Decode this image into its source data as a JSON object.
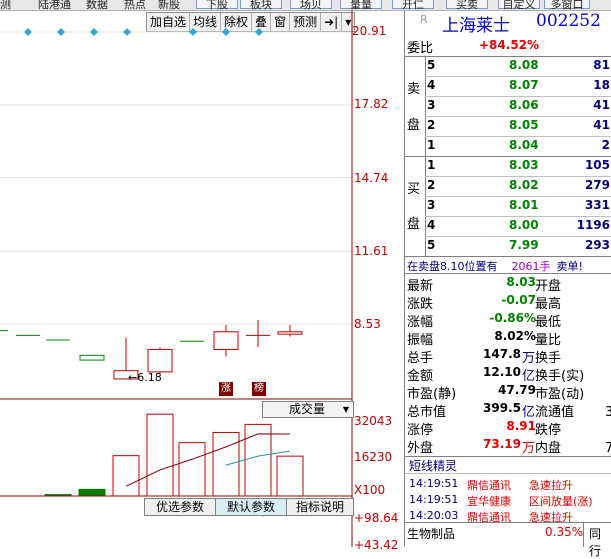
{
  "top_tabs": [
    "测",
    "陆港通",
    "数据",
    "热点",
    "新股"
  ],
  "top_buttons": [
    "下股",
    "板块",
    "场贝",
    "量量",
    "开仁",
    "买卖",
    "自定义",
    "多窗口"
  ],
  "chart_toolbar": [
    "加自选",
    "均线",
    "除权",
    "叠",
    "窗",
    "预测",
    "➜|",
    "▾"
  ],
  "price_axis": [
    "20.91",
    "17.82",
    "14.74",
    "11.61",
    "8.53"
  ],
  "volume_axis": [
    "32043",
    "16230",
    "X100"
  ],
  "indicator_axis": [
    "+98.64",
    "+43.42"
  ],
  "low_marker": "6.18",
  "markers": {
    "zhang": "涨",
    "bang": "榜"
  },
  "volume_dropdown": "成交量",
  "bottom_buttons": [
    "优选参数",
    "默认参数",
    "指标说明"
  ],
  "stock": {
    "name": "上海莱士",
    "code": "002252",
    "prefix": "R"
  },
  "order_ratio": {
    "label": "委比",
    "value": "+84.52%"
  },
  "sell_label": [
    "卖",
    "盘"
  ],
  "buy_label": [
    "买",
    "盘"
  ],
  "sell_orders": [
    {
      "level": "5",
      "price": "8.08",
      "vol": "81"
    },
    {
      "level": "4",
      "price": "8.07",
      "vol": "18"
    },
    {
      "level": "3",
      "price": "8.06",
      "vol": "41"
    },
    {
      "level": "2",
      "price": "8.05",
      "vol": "41"
    },
    {
      "level": "1",
      "price": "8.04",
      "vol": "2"
    }
  ],
  "buy_orders": [
    {
      "level": "1",
      "price": "8.03",
      "vol": "105"
    },
    {
      "level": "2",
      "price": "8.02",
      "vol": "279"
    },
    {
      "level": "3",
      "price": "8.01",
      "vol": "331"
    },
    {
      "level": "4",
      "price": "8.00",
      "vol": "1196"
    },
    {
      "level": "5",
      "price": "7.99",
      "vol": "293"
    }
  ],
  "notice": {
    "text1": "在卖盘8.10位置有",
    "vol": "2061",
    "unit": "手",
    "text2": "卖单!"
  },
  "quote_rows": [
    {
      "l": "最新",
      "v": "8.03",
      "u": "",
      "r": "开盘"
    },
    {
      "l": "涨跌",
      "v": "-0.07",
      "u": "",
      "r": "最高"
    },
    {
      "l": "涨幅",
      "v": "-0.86%",
      "u": "",
      "r": "最低"
    },
    {
      "l": "振幅",
      "v": "8.02%",
      "u": "",
      "r": "量比"
    },
    {
      "l": "总手",
      "v": "147.8",
      "u": "万",
      "r": "换手"
    },
    {
      "l": "金额",
      "v": "12.10",
      "u": "亿",
      "r": "换手(实)"
    },
    {
      "l": "市盈(静)",
      "v": "47.79",
      "u": "",
      "r": "市盈(动)"
    },
    {
      "l": "总市值",
      "v": "399.5",
      "u": "亿",
      "r": "流通值"
    },
    {
      "l": "涨停",
      "v": "8.91",
      "u": "",
      "r": "跌停"
    },
    {
      "l": "外盘",
      "v": "73.19",
      "u": "万",
      "r": "内盘"
    }
  ],
  "quote_right_tail": {
    "liutong": "3",
    "neipan": "7"
  },
  "news": {
    "title": "短线精灵",
    "items": [
      {
        "time": "14:19:51",
        "name": "鼎信通讯",
        "event": "急速拉升"
      },
      {
        "time": "14:19:51",
        "name": "宜华健康",
        "event": "区间放量(涨)"
      },
      {
        "time": "14:20:03",
        "name": "鼎信通讯",
        "event": "急速拉升"
      }
    ]
  },
  "sector": {
    "name": "生物制品",
    "change": "0.35%",
    "right": "同行"
  },
  "candles": [
    {
      "o": 8.25,
      "c": 8.25,
      "h": 8.25,
      "l": 8.25,
      "dir": "flat"
    },
    {
      "o": 8.05,
      "c": 8.05,
      "h": 8.05,
      "l": 8.05,
      "dir": "flat"
    },
    {
      "o": 7.85,
      "c": 7.85,
      "h": 7.85,
      "l": 7.85,
      "dir": "flat"
    },
    {
      "o": 7.0,
      "c": 7.2,
      "h": 7.2,
      "l": 7.0,
      "dir": "flat"
    },
    {
      "o": 6.2,
      "c": 6.55,
      "h": 7.95,
      "l": 6.18,
      "dir": "up"
    },
    {
      "o": 6.5,
      "c": 7.45,
      "h": 7.55,
      "l": 6.45,
      "dir": "up"
    },
    {
      "o": 7.8,
      "c": 7.8,
      "h": 7.8,
      "l": 7.8,
      "dir": "flat"
    },
    {
      "o": 7.45,
      "c": 8.2,
      "h": 8.5,
      "l": 7.15,
      "dir": "up"
    },
    {
      "o": 8.05,
      "c": 8.05,
      "h": 8.7,
      "l": 7.55,
      "dir": "cross"
    },
    {
      "o": 8.1,
      "c": 8.2,
      "h": 8.5,
      "l": 8.0,
      "dir": "up"
    }
  ],
  "volumes": [
    {
      "v": 0,
      "dir": "flat"
    },
    {
      "v": 0,
      "dir": "flat"
    },
    {
      "v": 600,
      "dir": "down"
    },
    {
      "v": 2800,
      "dir": "down"
    },
    {
      "v": 17000,
      "dir": "up"
    },
    {
      "v": 34500,
      "dir": "up"
    },
    {
      "v": 22500,
      "dir": "up"
    },
    {
      "v": 26800,
      "dir": "up"
    },
    {
      "v": 30200,
      "dir": "up"
    },
    {
      "v": 16800,
      "dir": "up"
    }
  ]
}
